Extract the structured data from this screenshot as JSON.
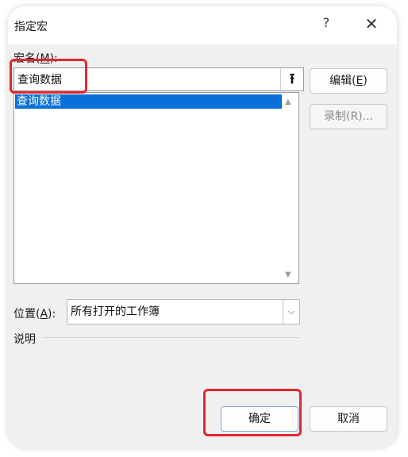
{
  "dialog": {
    "title": "指定宏",
    "help_glyph": "?",
    "close_glyph": "✕"
  },
  "macro_name": {
    "label_text": "宏名(",
    "label_key": "M",
    "label_suffix": "):",
    "value": "查询数据",
    "up_glyph": "⭱"
  },
  "macro_list": {
    "items": [
      "查询数据"
    ],
    "scroll_up_glyph": "▲",
    "scroll_down_glyph": "▼"
  },
  "side_buttons": {
    "edit_text": "编辑(",
    "edit_key": "E",
    "edit_suffix": ")",
    "record_label": "录制(R)..."
  },
  "location": {
    "label_text": "位置(",
    "label_key": "A",
    "label_suffix": "):",
    "selected": "所有打开的工作簿",
    "arrow_glyph": "⌵"
  },
  "description": {
    "label": "说明"
  },
  "footer": {
    "ok_label": "确定",
    "cancel_label": "取消"
  },
  "colors": {
    "highlight": "#e5262e",
    "selection": "#0a6fd8"
  }
}
